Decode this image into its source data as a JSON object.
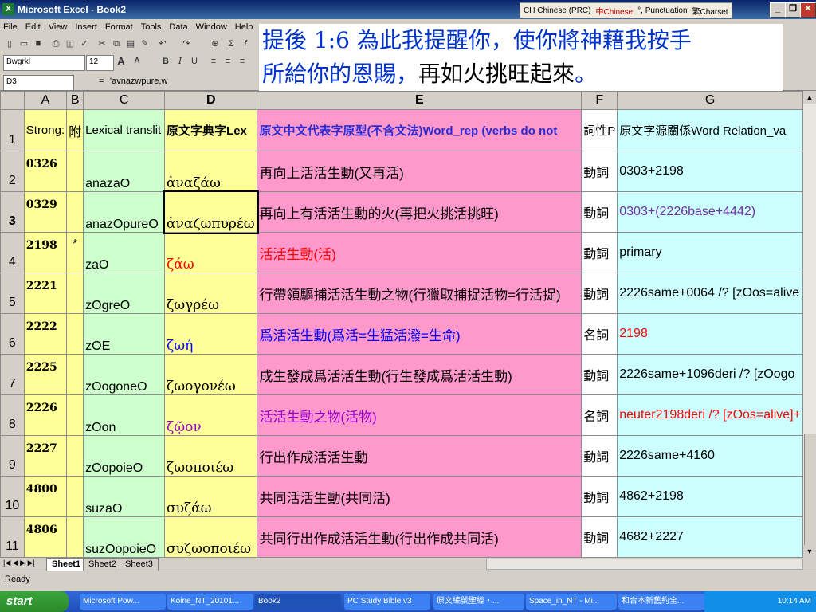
{
  "window": {
    "title": "Microsoft Excel - Book2"
  },
  "langbar": {
    "items": [
      "CH Chinese (PRC)",
      "中Chinese",
      "°, Punctuation",
      "繁Charset"
    ]
  },
  "menu": [
    "File",
    "Edit",
    "View",
    "Insert",
    "Format",
    "Tools",
    "Data",
    "Window",
    "Help"
  ],
  "format_toolbar": {
    "font": "Bwgrkl",
    "size": "12"
  },
  "formula_bar": {
    "name_box": "D3",
    "formula": "'avnazwpure,w"
  },
  "overlay": {
    "line1": "提後 1:6 為此我提醒你，使你將神藉我按手",
    "line2a": "所給你的恩賜，",
    "line2b": "再如火挑旺起來",
    "line2c": "。"
  },
  "columns": [
    "A",
    "B",
    "C",
    "D",
    "E",
    "F",
    "G"
  ],
  "header_row": [
    "Strong:",
    "附",
    "Lexical translit",
    "原文字典字Lex",
    "原文中文代表字原型(不含文法)Word_rep (verbs do not",
    "詞性P",
    "原文字源關係Word Relation_va"
  ],
  "rows": [
    {
      "num": "2",
      "A": "0326",
      "B": "",
      "C": "anazaO",
      "D": "ἀναζάω",
      "E": "再向上活活生動(又再活)",
      "F": "動詞",
      "G": "0303+2198"
    },
    {
      "num": "3",
      "A": "0329",
      "B": "",
      "C": "anazOpureO",
      "D": "ἀναζωπυρέω",
      "E": "再向上有活活生動的火(再把火挑活挑旺)",
      "F": "動詞",
      "G": "0303+(2226base+4442)"
    },
    {
      "num": "4",
      "A": "2198",
      "B": "*",
      "C": "zaO",
      "D": "ζάω",
      "E": "活活生動(活)",
      "F": "動詞",
      "G": "primary"
    },
    {
      "num": "5",
      "A": "2221",
      "B": "",
      "C": "zOgreO",
      "D": "ζωγρέω",
      "E": "行帶領驅捕活活生動之物(行獵取捕捉活物=行活捉)",
      "F": "動詞",
      "G": "2226same+0064 /? [zOos=alive"
    },
    {
      "num": "6",
      "A": "2222",
      "B": "",
      "C": "zOE",
      "D": "ζωή",
      "E": "爲活活生動(爲活=生猛活潑=生命)",
      "F": "名詞",
      "G": "2198"
    },
    {
      "num": "7",
      "A": "2225",
      "B": "",
      "C": "zOogoneO",
      "D": "ζωογονέω",
      "E": "成生發成爲活活生動(行生發成爲活活生動)",
      "F": "動詞",
      "G": "2226same+1096deri /? [zOogo"
    },
    {
      "num": "8",
      "A": "2226",
      "B": "",
      "C": "zOon",
      "D": "ζῷον",
      "E": "活活生動之物(活物)",
      "F": "名詞",
      "G": "neuter2198deri /? [zOos=alive]+"
    },
    {
      "num": "9",
      "A": "2227",
      "B": "",
      "C": "zOopoieO",
      "D": "ζωοποιέω",
      "E": "行出作成活活生動",
      "F": "動詞",
      "G": "2226same+4160"
    },
    {
      "num": "10",
      "A": "4800",
      "B": "",
      "C": "suzaO",
      "D": "συζάω",
      "E": "共同活活生動(共同活)",
      "F": "動詞",
      "G": "4862+2198"
    },
    {
      "num": "11",
      "A": "4806",
      "B": "",
      "C": "suzOopoieO",
      "D": "συζωοποιέω",
      "E": "共同行出作成活活生動(行出作成共同活)",
      "F": "動詞",
      "G": "4682+2227"
    }
  ],
  "colors": {
    "D_red": "#ff0000",
    "D_blue": "#0000ff",
    "D_purple": "#9900cc",
    "G_purple": "#7030a0",
    "G_red": "#ff0000"
  },
  "sheet_tabs": [
    "Sheet1",
    "Sheet2",
    "Sheet3"
  ],
  "status": "Ready",
  "taskbar": {
    "start": "start",
    "tasks": [
      "Microsoft Pow...",
      "Koine_NT_20101...",
      "Book2",
      "PC Study Bible v3",
      "原文編號聖經・...",
      "Space_in_NT - Mi...",
      "和合本新舊約全..."
    ],
    "clock": "10:14 AM"
  }
}
